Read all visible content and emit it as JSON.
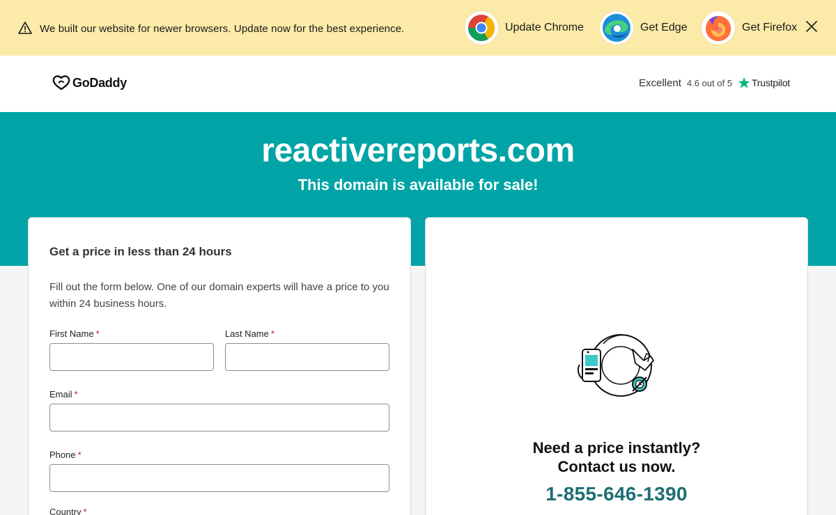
{
  "banner": {
    "message": "We built our website for newer browsers. Update now for the best experience.",
    "browsers": [
      {
        "label": "Update Chrome",
        "icon": "chrome-icon"
      },
      {
        "label": "Get Edge",
        "icon": "edge-icon"
      },
      {
        "label": "Get Firefox",
        "icon": "firefox-icon"
      }
    ],
    "warning_icon": "warning-icon",
    "close_icon": "close-icon"
  },
  "header": {
    "logo_text": "GoDaddy",
    "rating_word": "Excellent",
    "rating_score": "4.6 out of 5",
    "rating_brand": "Trustpilot"
  },
  "hero": {
    "domain": "reactivereports.com",
    "subtitle": "This domain is available for sale!"
  },
  "form": {
    "title": "Get a price in less than 24 hours",
    "description": "Fill out the form below. One of our domain experts will have a price to you within 24 business hours.",
    "required_mark": "*",
    "fields": {
      "first_name": {
        "label": "First Name",
        "value": ""
      },
      "last_name": {
        "label": "Last Name",
        "value": ""
      },
      "email": {
        "label": "Email",
        "value": ""
      },
      "phone": {
        "label": "Phone",
        "value": ""
      },
      "country": {
        "label": "Country"
      }
    }
  },
  "contact": {
    "question_line1": "Need a price instantly?",
    "question_line2": "Contact us now.",
    "phone": "1-855-646-1390"
  },
  "colors": {
    "banner_bg": "#fbeaa8",
    "hero_bg": "#00a4a6",
    "phone_text": "#1c6e73",
    "required_star": "#c8102e",
    "trustpilot_star": "#00b67a"
  }
}
